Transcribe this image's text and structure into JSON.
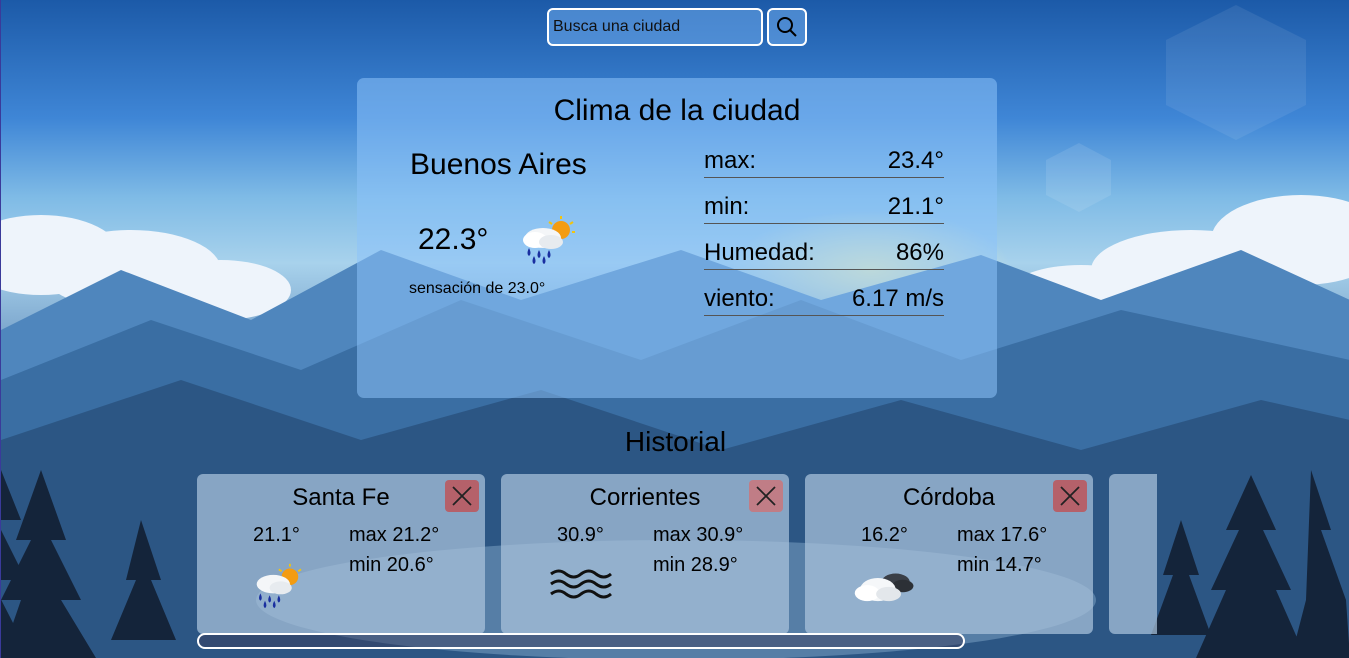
{
  "search": {
    "placeholder": "Busca una ciudad",
    "button_icon": "search-icon"
  },
  "main": {
    "title": "Clima de la ciudad",
    "city": "Buenos Aires",
    "temp": "22.3°",
    "feels_like": "sensación de 23.0°",
    "icon": "rain-sun-icon",
    "stats": [
      {
        "label": "max:",
        "value": "23.4°"
      },
      {
        "label": "min:",
        "value": "21.1°"
      },
      {
        "label": "Humedad:",
        "value": "86%"
      },
      {
        "label": "viento:",
        "value": "6.17 m/s"
      }
    ]
  },
  "history": {
    "title": "Historial",
    "cards": [
      {
        "city": "Santa Fe",
        "temp": "21.1°",
        "max": "max 21.2°",
        "min": "min 20.6°",
        "icon": "rain-sun-icon"
      },
      {
        "city": "Corrientes",
        "temp": "30.9°",
        "max": "max 30.9°",
        "min": "min 28.9°",
        "icon": "mist-icon"
      },
      {
        "city": "Córdoba",
        "temp": "16.2°",
        "max": "max 17.6°",
        "min": "min 14.7°",
        "icon": "cloudy-icon"
      },
      {
        "city": "",
        "temp": "",
        "max": "",
        "min": "",
        "icon": ""
      }
    ]
  },
  "colors": {
    "delete_button": "#b5616a",
    "card_main": "#8cc3fa",
    "card_history": "#aac3dc"
  }
}
